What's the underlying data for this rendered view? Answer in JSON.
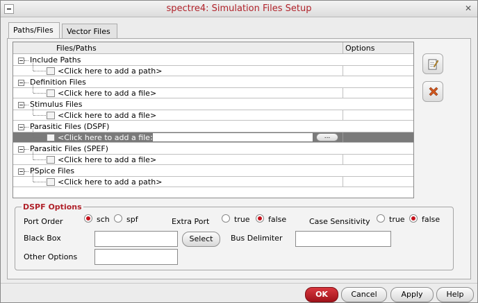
{
  "window": {
    "title": "spectre4: Simulation Files Setup"
  },
  "tabs": [
    {
      "label": "Paths/Files",
      "active": true
    },
    {
      "label": "Vector Files",
      "active": false
    }
  ],
  "table": {
    "columns": [
      "Files/Paths",
      "Options"
    ],
    "groups": [
      {
        "label": "Include Paths",
        "child": "<Click here to add a path>"
      },
      {
        "label": "Definition Files",
        "child": "<Click here to add a file>"
      },
      {
        "label": "Stimulus Files",
        "child": "<Click here to add a file>"
      },
      {
        "label": "Parasitic Files (DSPF)",
        "child": "<Click here to add a file>",
        "selected": true,
        "browse": "..."
      },
      {
        "label": "Parasitic Files (SPEF)",
        "child": "<Click here to add a file>"
      },
      {
        "label": "PSpice Files",
        "child": "<Click here to add a path>"
      }
    ]
  },
  "side_buttons": {
    "edit_icon": "edit-icon",
    "delete_icon": "x-icon"
  },
  "dspf": {
    "title": "DSPF Options",
    "port_order_label": "Port Order",
    "port_order_options": [
      "sch",
      "spf"
    ],
    "port_order_selected": "sch",
    "extra_port_label": "Extra Port",
    "extra_port_options": [
      "true",
      "false"
    ],
    "extra_port_selected": "false",
    "case_label": "Case Sensitivity",
    "case_options": [
      "true",
      "false"
    ],
    "case_selected": "false",
    "black_box_label": "Black Box",
    "black_box_value": "",
    "select_label": "Select",
    "bus_delimiter_label": "Bus Delimiter",
    "bus_delimiter_value": "",
    "other_options_label": "Other Options",
    "other_options_value": ""
  },
  "footer": {
    "ok": "OK",
    "cancel": "Cancel",
    "apply": "Apply",
    "help": "Help"
  },
  "colors": {
    "accent": "#b0222a",
    "ok_button": "#c4121c",
    "selected_row": "#7a7a7a"
  }
}
